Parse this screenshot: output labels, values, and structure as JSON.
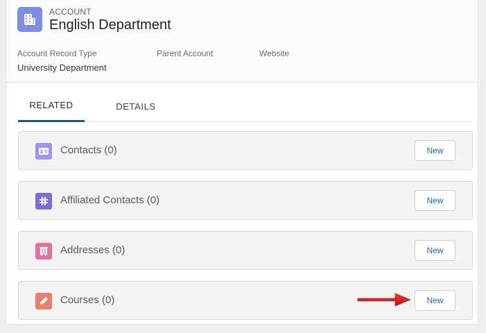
{
  "header": {
    "object_label": "ACCOUNT",
    "record_name": "English Department",
    "icon": "building-icon",
    "fields": [
      {
        "label": "Account Record Type",
        "value": "University Department"
      },
      {
        "label": "Parent Account",
        "value": ""
      },
      {
        "label": "Website",
        "value": ""
      }
    ]
  },
  "tabs": [
    {
      "label": "RELATED",
      "active": true
    },
    {
      "label": "DETAILS",
      "active": false
    }
  ],
  "related_lists": [
    {
      "title": "Contacts (0)",
      "icon": "contact-card-icon",
      "icon_color": "#a094ed",
      "button": "New"
    },
    {
      "title": "Affiliated Contacts (0)",
      "icon": "hashtag-icon",
      "icon_color": "#7a6fd8",
      "button": "New"
    },
    {
      "title": "Addresses (0)",
      "icon": "address-building-icon",
      "icon_color": "#e2729b",
      "button": "New"
    },
    {
      "title": "Courses (0)",
      "icon": "pencil-icon",
      "icon_color": "#e8806b",
      "button": "New"
    }
  ],
  "colors": {
    "accent": "#1b5297",
    "button_text": "#1b6bb5",
    "annotation_arrow": "#e21b1b"
  }
}
